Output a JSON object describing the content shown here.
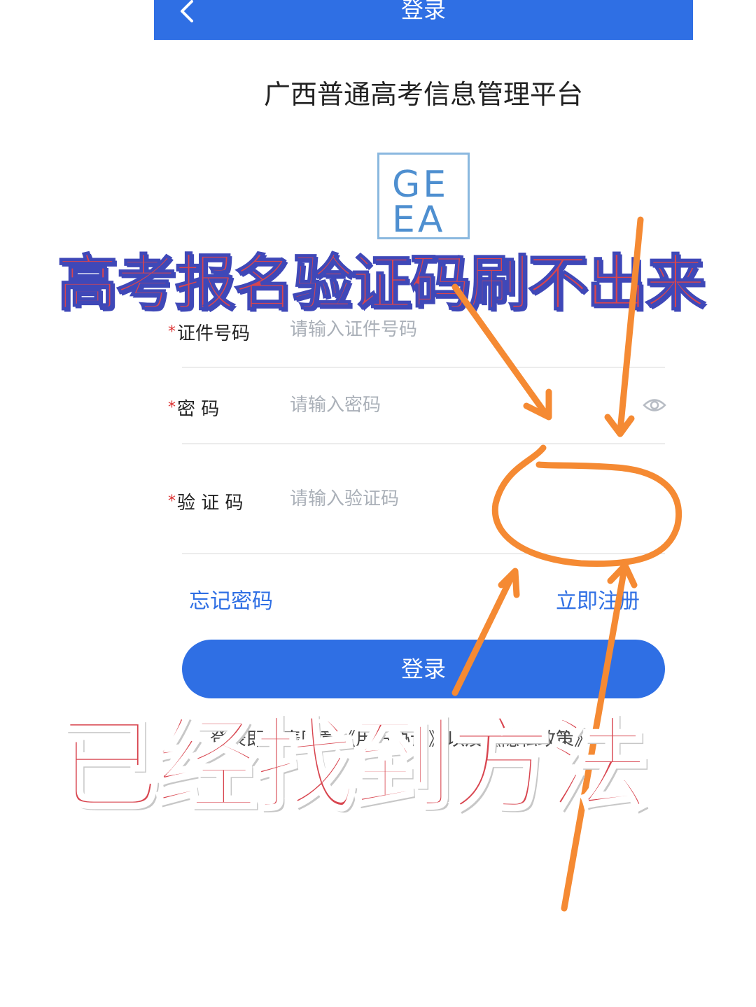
{
  "topbar": {
    "title": "登录"
  },
  "platform_title": "广西普通高考信息管理平台",
  "logo": {
    "text_line1": "GE",
    "text_line2": "EA"
  },
  "form": {
    "id_label": "证件号码",
    "id_placeholder": "请输入证件号码",
    "password_label": "密 码",
    "password_placeholder": "请输入密码",
    "captcha_label": "验 证 码",
    "captcha_placeholder": "请输入验证码",
    "required_mark": "*"
  },
  "links": {
    "forgot": "忘记密码",
    "register": "立即注册"
  },
  "login_button": "登录",
  "agreement_text": "登录即代表同意《用户协议》以及《隐私政策》",
  "overlay": {
    "headline_top": "高考报名验证码刷不出来",
    "headline_bottom": "已经找到方法"
  },
  "colors": {
    "accent": "#2f6fe4",
    "annotation": "#f58a33",
    "headline": "#d8454f"
  },
  "icons": {
    "back": "chevron-left-icon",
    "eye": "eye-icon"
  }
}
